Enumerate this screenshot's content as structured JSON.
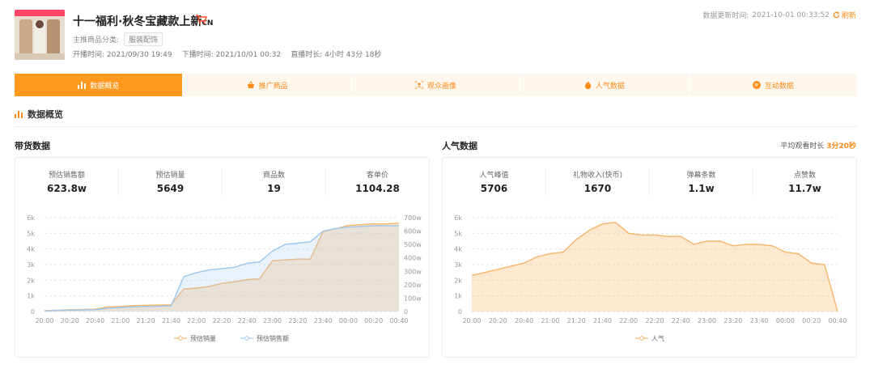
{
  "header": {
    "title": "十一福利·秋冬宝藏款上新",
    "title_suffix": "CN",
    "category_label": "主推商品分类:",
    "category_value": "服装配饰",
    "start_label": "开播时间:",
    "start_value": "2021/09/30 19:49",
    "end_label": "下播时间:",
    "end_value": "2021/10/01 00:32",
    "duration_label": "直播时长:",
    "duration_value": "4小时 43分 18秒",
    "update_label": "数据更新时间:",
    "update_value": "2021-10-01 00:33:52",
    "refresh_label": "刷新"
  },
  "tabs": [
    {
      "label": "数据概览",
      "icon": "bar-chart-icon",
      "active": true
    },
    {
      "label": "推广商品",
      "icon": "basket-icon",
      "active": false
    },
    {
      "label": "观众画像",
      "icon": "portrait-icon",
      "active": false
    },
    {
      "label": "人气数据",
      "icon": "flame-icon",
      "active": false
    },
    {
      "label": "互动数据",
      "icon": "interaction-icon",
      "active": false
    }
  ],
  "section_title": "数据概览",
  "sales": {
    "title": "带货数据",
    "stats": [
      {
        "label": "预估销售额",
        "value": "623.8w"
      },
      {
        "label": "预估销量",
        "value": "5649"
      },
      {
        "label": "商品数",
        "value": "19"
      },
      {
        "label": "客单价",
        "value": "1104.28"
      }
    ]
  },
  "popularity": {
    "title": "人气数据",
    "avg_label": "平均观看时长",
    "avg_value": "3分20秒",
    "stats": [
      {
        "label": "人气峰值",
        "value": "5706"
      },
      {
        "label": "礼物收入(快币)",
        "value": "1670"
      },
      {
        "label": "弹幕条数",
        "value": "1.1w"
      },
      {
        "label": "点赞数",
        "value": "11.7w"
      }
    ]
  },
  "colors": {
    "accent": "#ff9a1f",
    "orange_line": "#f7b46a",
    "blue_line": "#9cc8f0"
  },
  "chart_data": [
    {
      "type": "line",
      "x": [
        "20:00",
        "20:10",
        "20:20",
        "20:30",
        "20:40",
        "20:50",
        "21:00",
        "21:10",
        "21:20",
        "21:30",
        "21:40",
        "21:50",
        "22:00",
        "22:10",
        "22:20",
        "22:30",
        "22:40",
        "22:50",
        "23:00",
        "23:10",
        "23:20",
        "23:30",
        "23:40",
        "23:50",
        "00:00",
        "00:10",
        "00:20",
        "00:30",
        "00:40"
      ],
      "x_ticks": [
        "20:00",
        "20:20",
        "20:40",
        "21:00",
        "21:20",
        "21:40",
        "22:00",
        "22:20",
        "22:40",
        "23:00",
        "23:20",
        "23:40",
        "00:00",
        "00:20",
        "00:40"
      ],
      "y_ticks_left": [
        "0",
        "1k",
        "2k",
        "3k",
        "4k",
        "5k",
        "6k"
      ],
      "y_ticks_right": [
        "0",
        "100w",
        "200w",
        "300w",
        "400w",
        "500w",
        "600w",
        "700w"
      ],
      "ylim_left": [
        0,
        6000
      ],
      "ylim_right": [
        0,
        700
      ],
      "series": [
        {
          "name": "预估销量",
          "axis": "left",
          "values": [
            50,
            80,
            120,
            130,
            150,
            300,
            320,
            380,
            400,
            420,
            430,
            1450,
            1500,
            1600,
            1800,
            1900,
            2050,
            2100,
            3250,
            3300,
            3350,
            3350,
            5100,
            5300,
            5500,
            5550,
            5600,
            5600,
            5650
          ]
        },
        {
          "name": "预估销售额",
          "axis": "right",
          "values": [
            5,
            8,
            10,
            12,
            14,
            25,
            30,
            35,
            38,
            40,
            42,
            260,
            290,
            310,
            320,
            330,
            360,
            370,
            450,
            500,
            510,
            520,
            600,
            620,
            630,
            635,
            640,
            640,
            640
          ]
        }
      ],
      "legend": "bottom"
    },
    {
      "type": "area",
      "x": [
        "20:00",
        "20:10",
        "20:20",
        "20:30",
        "20:40",
        "20:50",
        "21:00",
        "21:10",
        "21:20",
        "21:30",
        "21:40",
        "21:50",
        "22:00",
        "22:10",
        "22:20",
        "22:30",
        "22:40",
        "22:50",
        "23:00",
        "23:10",
        "23:20",
        "23:30",
        "23:40",
        "23:50",
        "00:00",
        "00:10",
        "00:20",
        "00:30",
        "00:40"
      ],
      "x_ticks": [
        "20:00",
        "20:20",
        "20:40",
        "21:00",
        "21:20",
        "21:40",
        "22:00",
        "22:20",
        "22:40",
        "23:00",
        "23:20",
        "23:40",
        "00:00",
        "00:20",
        "00:40"
      ],
      "y_ticks": [
        "0",
        "1k",
        "2k",
        "3k",
        "4k",
        "5k",
        "6k"
      ],
      "ylim": [
        0,
        6000
      ],
      "series": [
        {
          "name": "人气",
          "values": [
            2300,
            2500,
            2700,
            2900,
            3100,
            3500,
            3700,
            3800,
            4600,
            5200,
            5600,
            5700,
            5000,
            4900,
            4900,
            4800,
            4800,
            4300,
            4500,
            4500,
            4200,
            4300,
            4300,
            4200,
            3800,
            3700,
            3100,
            3000,
            0
          ]
        }
      ],
      "legend": "bottom"
    }
  ]
}
